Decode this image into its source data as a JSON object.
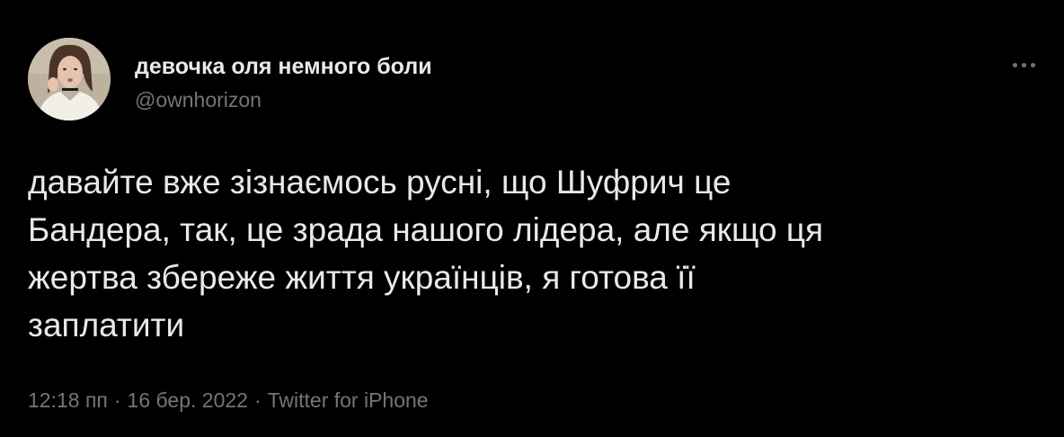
{
  "author": {
    "display_name": "девочка оля немного боли",
    "handle": "@ownhorizon"
  },
  "tweet": {
    "lines": [
      "давайте вже зізнаємось русні, що Шуфрич це",
      "Бандера, так, це зрада нашого лідера, але якщо ця",
      "жертва збереже життя українців, я готова її",
      "заплатити"
    ]
  },
  "meta": {
    "time": "12:18 пп",
    "separator": "·",
    "date": "16 бер. 2022",
    "source": "Twitter for iPhone"
  },
  "icons": {
    "more": "more-horizontal-icon"
  },
  "colors": {
    "background": "#000000",
    "primary_text": "#e7e9ea",
    "secondary_text": "#71767b"
  }
}
